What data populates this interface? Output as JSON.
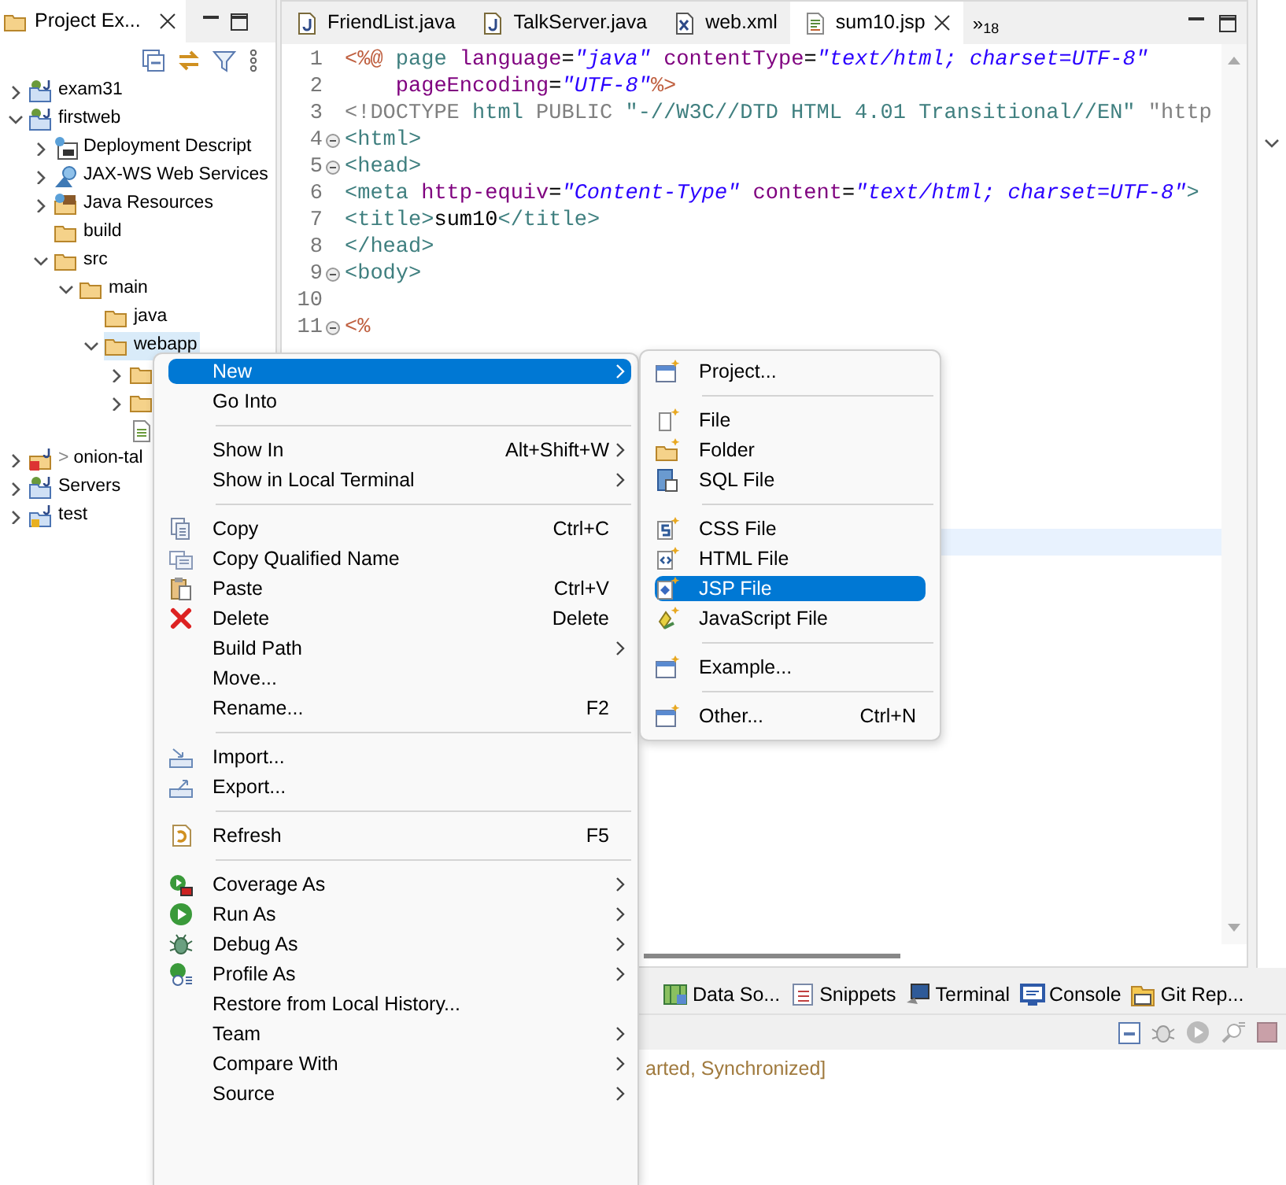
{
  "explorer": {
    "title": "Project Ex...",
    "tree": [
      {
        "label": "exam31",
        "kind": "project",
        "expanded": false,
        "selected": false
      },
      {
        "label": "firstweb",
        "kind": "project",
        "expanded": true,
        "selected": false,
        "children": [
          {
            "label": "Deployment Descript",
            "kind": "descriptor",
            "expanded": false,
            "selected": false
          },
          {
            "label": "JAX-WS Web Services",
            "kind": "webservices",
            "expanded": false,
            "selected": false
          },
          {
            "label": "Java Resources",
            "kind": "library",
            "expanded": false,
            "selected": false
          },
          {
            "label": "build",
            "kind": "folder",
            "selected": false
          },
          {
            "label": "src",
            "kind": "folder",
            "expanded": true,
            "selected": false,
            "children": [
              {
                "label": "main",
                "kind": "folder",
                "expanded": true,
                "selected": false,
                "children": [
                  {
                    "label": "java",
                    "kind": "folder",
                    "selected": false
                  },
                  {
                    "label": "webapp",
                    "kind": "folder",
                    "expanded": true,
                    "selected": true,
                    "children": [
                      {
                        "kind": "folder",
                        "expanded": false,
                        "selected": false
                      },
                      {
                        "kind": "folder",
                        "expanded": false,
                        "selected": false
                      },
                      {
                        "kind": "file",
                        "selected": false
                      }
                    ]
                  }
                ]
              }
            ]
          }
        ]
      },
      {
        "label": "onion-tal",
        "decoration": ">",
        "kind": "projecterror",
        "expanded": false,
        "selected": false
      },
      {
        "label": "Servers",
        "kind": "project",
        "expanded": false,
        "selected": false
      },
      {
        "label": "test",
        "kind": "projectlock",
        "expanded": false,
        "selected": false
      }
    ]
  },
  "editor": {
    "tabs": [
      {
        "label": "FriendList.java",
        "kind": "java",
        "selected": false
      },
      {
        "label": "TalkServer.java",
        "kind": "java",
        "selected": false
      },
      {
        "label": "web.xml",
        "kind": "xml",
        "selected": false
      },
      {
        "label": "sum10.jsp",
        "kind": "jsp",
        "selected": true
      }
    ],
    "overflow": "»$_{18}$",
    "lines": [
      {
        "number": "1",
        "fold": false,
        "tokens": [
          {
            "kind": "jsp",
            "text": "<%@ "
          },
          {
            "kind": "tag",
            "text": "page "
          },
          {
            "kind": "attr",
            "text": "language"
          },
          {
            "kind": "plain",
            "text": "="
          },
          {
            "kind": "str",
            "text": "\"java\" "
          },
          {
            "kind": "attr",
            "text": "contentType"
          },
          {
            "kind": "plain",
            "text": "="
          },
          {
            "kind": "str",
            "text": "\"text/html; charset=UTF-8\""
          }
        ]
      },
      {
        "number": "2",
        "fold": false,
        "tokens": [
          {
            "kind": "attr",
            "text": "    pageEncoding"
          },
          {
            "kind": "plain",
            "text": "="
          },
          {
            "kind": "str",
            "text": "\"UTF-8\""
          },
          {
            "kind": "jsp",
            "text": "%>"
          }
        ]
      },
      {
        "number": "3",
        "fold": false,
        "tokens": [
          {
            "kind": "doctype",
            "text": "<!DOCTYPE "
          },
          {
            "kind": "tag",
            "text": "html"
          },
          {
            "kind": "doctype",
            "text": " PUBLIC "
          },
          {
            "kind": "tag",
            "text": "\"-//W3C//DTD HTML 4.01 Transitional//EN\""
          },
          {
            "kind": "doctype",
            "text": " \"http"
          }
        ]
      },
      {
        "number": "4",
        "fold": true,
        "tokens": [
          {
            "kind": "tag",
            "text": "<html>"
          }
        ]
      },
      {
        "number": "5",
        "fold": true,
        "tokens": [
          {
            "kind": "tag",
            "text": "<head>"
          }
        ]
      },
      {
        "number": "6",
        "fold": false,
        "tokens": [
          {
            "kind": "tag",
            "text": "<meta "
          },
          {
            "kind": "attr",
            "text": "http-equiv"
          },
          {
            "kind": "plain",
            "text": "="
          },
          {
            "kind": "str",
            "text": "\"Content-Type\" "
          },
          {
            "kind": "attr",
            "text": "content"
          },
          {
            "kind": "plain",
            "text": "="
          },
          {
            "kind": "str",
            "text": "\"text/html; charset=UTF-8\""
          },
          {
            "kind": "tag",
            "text": ">"
          }
        ]
      },
      {
        "number": "7",
        "fold": false,
        "tokens": [
          {
            "kind": "tag",
            "text": "<title>"
          },
          {
            "kind": "plain",
            "text": "sum10"
          },
          {
            "kind": "tag",
            "text": "</title>"
          }
        ]
      },
      {
        "number": "8",
        "fold": false,
        "tokens": [
          {
            "kind": "tag",
            "text": "</head>"
          }
        ]
      },
      {
        "number": "9",
        "fold": true,
        "tokens": [
          {
            "kind": "tag",
            "text": "<body>"
          }
        ]
      },
      {
        "number": "10",
        "fold": false
      },
      {
        "number": "11",
        "fold": true,
        "tokens": [
          {
            "kind": "jsp",
            "text": "<%"
          }
        ]
      }
    ]
  },
  "bottom_panel": {
    "tabs": [
      {
        "label": "Data So...",
        "kind": "datasource",
        "selected": false
      },
      {
        "label": "Snippets",
        "kind": "snippets",
        "selected": false
      },
      {
        "label": "Terminal",
        "kind": "terminal",
        "selected": false
      },
      {
        "label": "Console",
        "kind": "console",
        "selected": false
      },
      {
        "label": "Git Rep...",
        "kind": "git",
        "selected": false
      }
    ],
    "status": "arted, Synchronized]"
  },
  "context_menu": {
    "items": [
      {
        "kind": "plain",
        "label": "New",
        "submenu": true,
        "selected": true
      },
      {
        "kind": "plain",
        "label": "Go Into",
        "submenu": false,
        "selected": false
      },
      {
        "kind": "separator"
      },
      {
        "kind": "plain",
        "label": "Show In",
        "shortcut": "Alt+Shift+W",
        "submenu": true,
        "selected": false
      },
      {
        "kind": "plain",
        "label": "Show in Local Terminal",
        "submenu": true,
        "selected": false
      },
      {
        "kind": "separator"
      },
      {
        "kind": "copy",
        "label": "Copy",
        "shortcut": "Ctrl+C",
        "submenu": false,
        "selected": false
      },
      {
        "kind": "copyq",
        "label": "Copy Qualified Name",
        "submenu": false,
        "selected": false
      },
      {
        "kind": "paste",
        "label": "Paste",
        "shortcut": "Ctrl+V",
        "submenu": false,
        "selected": false
      },
      {
        "kind": "delete",
        "label": "Delete",
        "shortcut": "Delete",
        "submenu": false,
        "selected": false
      },
      {
        "kind": "plain",
        "label": "Build Path",
        "submenu": true,
        "selected": false
      },
      {
        "kind": "plain",
        "label": "Move...",
        "submenu": false,
        "selected": false
      },
      {
        "kind": "plain",
        "label": "Rename...",
        "shortcut": "F2",
        "submenu": false,
        "selected": false
      },
      {
        "kind": "separator"
      },
      {
        "kind": "import",
        "label": "Import...",
        "submenu": false,
        "selected": false
      },
      {
        "kind": "export",
        "label": "Export...",
        "submenu": false,
        "selected": false
      },
      {
        "kind": "separator"
      },
      {
        "kind": "refresh",
        "label": "Refresh",
        "shortcut": "F5",
        "submenu": false,
        "selected": false
      },
      {
        "kind": "separator"
      },
      {
        "kind": "coverage",
        "label": "Coverage As",
        "submenu": true,
        "selected": false
      },
      {
        "kind": "run",
        "label": "Run As",
        "submenu": true,
        "selected": false
      },
      {
        "kind": "debug",
        "label": "Debug As",
        "submenu": true,
        "selected": false
      },
      {
        "kind": "profile",
        "label": "Profile As",
        "submenu": true,
        "selected": false
      },
      {
        "kind": "plain",
        "label": "Restore from Local History...",
        "submenu": false,
        "selected": false
      },
      {
        "kind": "plain",
        "label": "Team",
        "submenu": true,
        "selected": false
      },
      {
        "kind": "plain",
        "label": "Compare With",
        "submenu": true,
        "selected": false
      },
      {
        "kind": "plain",
        "label": "Source",
        "submenu": true,
        "selected": false
      }
    ]
  },
  "submenu": {
    "items": [
      {
        "kind": "newwindow",
        "label": "Project...",
        "selected": false
      },
      {
        "kind": "separator"
      },
      {
        "kind": "newfile",
        "label": "File",
        "selected": false
      },
      {
        "kind": "newfolder",
        "label": "Folder",
        "selected": false
      },
      {
        "kind": "sql",
        "label": "SQL File",
        "selected": false
      },
      {
        "kind": "separator"
      },
      {
        "kind": "css",
        "label": "CSS File",
        "selected": false
      },
      {
        "kind": "html",
        "label": "HTML File",
        "selected": false
      },
      {
        "kind": "jspnew",
        "label": "JSP File",
        "selected": true
      },
      {
        "kind": "js",
        "label": "JavaScript File",
        "selected": false
      },
      {
        "kind": "separator"
      },
      {
        "kind": "newwindow",
        "label": "Example...",
        "selected": false
      },
      {
        "kind": "separator"
      },
      {
        "kind": "newwindow",
        "label": "Other...",
        "shortcut": "Ctrl+N",
        "selected": false
      }
    ]
  }
}
